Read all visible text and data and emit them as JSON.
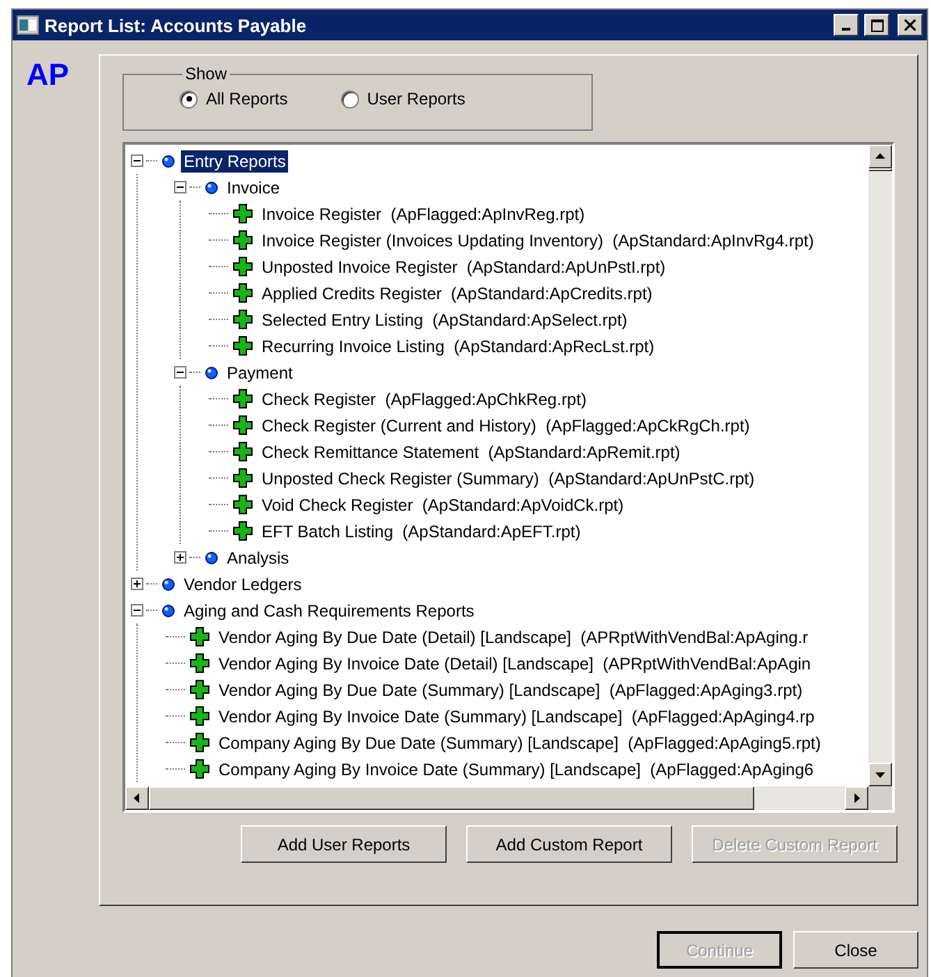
{
  "window": {
    "title": "Report List: Accounts Payable"
  },
  "module_label": "AP",
  "show": {
    "legend": "Show",
    "options": [
      {
        "label": "All Reports",
        "selected": true
      },
      {
        "label": "User Reports",
        "selected": false
      }
    ]
  },
  "tree": [
    {
      "kind": "folder",
      "label": "Entry Reports",
      "selected": true,
      "expanded": true,
      "children": [
        {
          "kind": "folder",
          "label": "Invoice",
          "selected": false,
          "expanded": true,
          "children": [
            {
              "kind": "report",
              "label": "Invoice Register  (ApFlagged:ApInvReg.rpt)",
              "selected": false
            },
            {
              "kind": "report",
              "label": "Invoice Register (Invoices Updating Inventory)  (ApStandard:ApInvRg4.rpt)",
              "selected": false
            },
            {
              "kind": "report",
              "label": "Unposted Invoice Register  (ApStandard:ApUnPstI.rpt)",
              "selected": false
            },
            {
              "kind": "report",
              "label": "Applied Credits Register  (ApStandard:ApCredits.rpt)",
              "selected": false
            },
            {
              "kind": "report",
              "label": "Selected Entry Listing  (ApStandard:ApSelect.rpt)",
              "selected": false
            },
            {
              "kind": "report",
              "label": "Recurring Invoice Listing  (ApStandard:ApRecLst.rpt)",
              "selected": false
            }
          ]
        },
        {
          "kind": "folder",
          "label": "Payment",
          "selected": false,
          "expanded": true,
          "children": [
            {
              "kind": "report",
              "label": "Check Register  (ApFlagged:ApChkReg.rpt)",
              "selected": false
            },
            {
              "kind": "report",
              "label": "Check Register (Current and History)  (ApFlagged:ApCkRgCh.rpt)",
              "selected": false
            },
            {
              "kind": "report",
              "label": "Check Remittance Statement  (ApStandard:ApRemit.rpt)",
              "selected": false
            },
            {
              "kind": "report",
              "label": "Unposted Check Register (Summary)  (ApStandard:ApUnPstC.rpt)",
              "selected": false
            },
            {
              "kind": "report",
              "label": "Void Check Register  (ApStandard:ApVoidCk.rpt)",
              "selected": false
            },
            {
              "kind": "report",
              "label": "EFT Batch Listing  (ApStandard:ApEFT.rpt)",
              "selected": false
            }
          ]
        },
        {
          "kind": "folder",
          "label": "Analysis",
          "selected": false,
          "expanded": false
        }
      ]
    },
    {
      "kind": "folder",
      "label": "Vendor Ledgers",
      "selected": false,
      "expanded": false
    },
    {
      "kind": "folder",
      "label": "Aging and Cash Requirements Reports",
      "selected": false,
      "expanded": true,
      "children": [
        {
          "kind": "report",
          "label": "Vendor Aging By Due Date (Detail) [Landscape]  (APRptWithVendBal:ApAging.r",
          "selected": false
        },
        {
          "kind": "report",
          "label": "Vendor Aging By Invoice Date (Detail) [Landscape]  (APRptWithVendBal:ApAgin",
          "selected": false
        },
        {
          "kind": "report",
          "label": "Vendor Aging By Due Date (Summary) [Landscape]  (ApFlagged:ApAging3.rpt)",
          "selected": false
        },
        {
          "kind": "report",
          "label": "Vendor Aging By Invoice Date (Summary) [Landscape]  (ApFlagged:ApAging4.rp",
          "selected": false
        },
        {
          "kind": "report",
          "label": "Company Aging By Due Date (Summary) [Landscape]  (ApFlagged:ApAging5.rpt)",
          "selected": false
        },
        {
          "kind": "report",
          "label": "Company Aging By Invoice Date (Summary) [Landscape]  (ApFlagged:ApAging6",
          "selected": false
        }
      ]
    }
  ],
  "tree_buttons": [
    {
      "label": "Add User Reports",
      "disabled": false
    },
    {
      "label": "Add Custom Report",
      "disabled": false
    },
    {
      "label": "Delete Custom Report",
      "disabled": true
    }
  ],
  "dialog_buttons": [
    {
      "label": "Continue",
      "disabled": true,
      "default": true
    },
    {
      "label": "Close",
      "disabled": false,
      "default": false
    }
  ]
}
